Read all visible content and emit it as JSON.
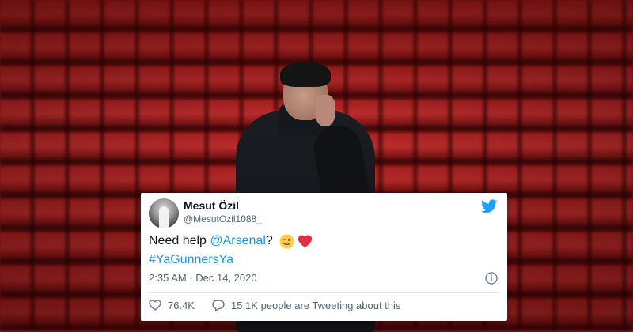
{
  "tweet": {
    "display_name": "Mesut Özil",
    "handle": "@MesutOzil1088_",
    "body": {
      "prefix": "Need help ",
      "mention": "@Arsenal",
      "suffix": "?",
      "emojis": [
        "winking-face-emoji",
        "red-heart-emoji"
      ],
      "hashtag": "#YaGunnersYa"
    },
    "timestamp": "2:35 AM · Dec 14, 2020",
    "likes": "76.4K",
    "tweeting_about": "15.1K people are Tweeting about this"
  },
  "icons": {
    "brand": "twitter-bird-icon",
    "info": "info-icon",
    "like": "heart-outline-icon",
    "reply": "speech-bubble-icon"
  },
  "colors": {
    "twitter_blue": "#1da1f2",
    "link_blue": "#1b95e0",
    "stadium_red": "#b52323"
  }
}
